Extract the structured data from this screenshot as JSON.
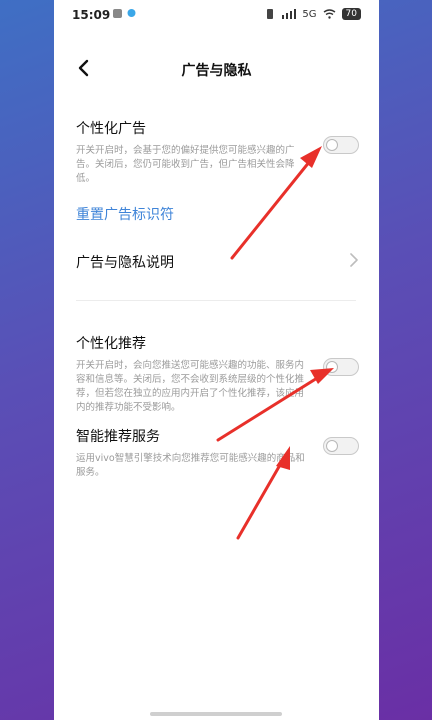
{
  "status_bar": {
    "time": "15:09",
    "right_text": "5G",
    "battery": "70"
  },
  "header": {
    "title": "广告与隐私"
  },
  "personalized_ads": {
    "title": "个性化广告",
    "description": "开关开启时，会基于您的偏好提供您可能感兴趣的广告。关闭后，您仍可能收到广告，但广告相关性会降低。",
    "enabled": false
  },
  "reset_ad_id": {
    "label": "重置广告标识符"
  },
  "ad_privacy_info": {
    "label": "广告与隐私说明"
  },
  "personalized_recommend": {
    "title": "个性化推荐",
    "description": "开关开启时，会向您推送您可能感兴趣的功能、服务内容和信息等。关闭后，您不会收到系统层级的个性化推荐，但若您在独立的应用内开启了个性化推荐，该应用内的推荐功能不受影响。",
    "enabled": false
  },
  "smart_recommend": {
    "title": "智能推荐服务",
    "description": "运用vivo智慧引擎技术向您推荐您可能感兴趣的商品和服务。",
    "enabled": false
  },
  "colors": {
    "link": "#3f84d8",
    "annotation_arrow": "#e8302a"
  }
}
